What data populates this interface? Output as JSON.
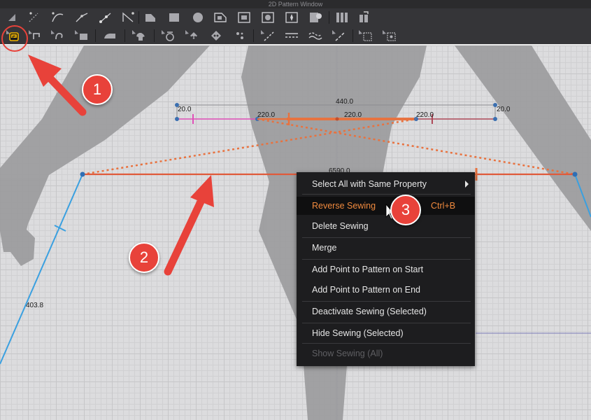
{
  "window": {
    "title": "2D Pattern Window"
  },
  "toolbar_row1_icons": [
    "select-tool-icon",
    "edit-point-icon",
    "edit-curve-icon",
    "curve-point-icon",
    "polygon-icon",
    "internal-line-icon",
    "rectangle-icon",
    "circle-icon",
    "ellipse-icon",
    "internal-polygon-icon",
    "internal-rectangle-icon",
    "internal-circle-icon",
    "dart-icon",
    "trace-icon",
    "grain-icon",
    "fold-icon"
  ],
  "toolbar_row2_icons": [
    "edit-sewing-icon",
    "segment-sewing-icon",
    "free-sewing-icon",
    "m-n-sewing-icon",
    "check-sewing-icon",
    "iron-icon",
    "fold-arrangement-icon",
    "tack-icon",
    "pin-icon",
    "button-icon",
    "buttonhole-icon",
    "topstitch-icon",
    "segment-topstitch-icon",
    "free-topstitch-icon",
    "puckering-icon",
    "zipper-icon",
    "pattern-grid-icon",
    "texture-grid-icon"
  ],
  "measurements": {
    "top_total": "440.0",
    "left_offset": "20.0",
    "right_offset": "20.0",
    "seg_left": "220.0",
    "seg_mid": "220.0",
    "seg_right": "220.0",
    "center_overlap": "6590.0",
    "left_edge": "403.8"
  },
  "context_menu": {
    "items": [
      {
        "label": "Select All with Same Property",
        "shortcut": "",
        "submenu": true,
        "state": "normal"
      },
      {
        "label": "Reverse Sewing",
        "shortcut": "Ctrl+B",
        "submenu": false,
        "state": "active"
      },
      {
        "label": "Delete Sewing",
        "shortcut": "",
        "submenu": false,
        "state": "normal"
      },
      {
        "label": "Merge",
        "shortcut": "",
        "submenu": false,
        "state": "normal"
      },
      {
        "label": "Add Point to Pattern on Start",
        "shortcut": "",
        "submenu": false,
        "state": "normal"
      },
      {
        "label": "Add Point to Pattern on End",
        "shortcut": "",
        "submenu": false,
        "state": "normal"
      },
      {
        "label": "Deactivate Sewing (Selected)",
        "shortcut": "",
        "submenu": false,
        "state": "normal"
      },
      {
        "label": "Hide Sewing (Selected)",
        "shortcut": "",
        "submenu": false,
        "state": "normal"
      },
      {
        "label": "Show Sewing (All)",
        "shortcut": "",
        "submenu": false,
        "state": "disabled"
      }
    ]
  },
  "annotations": {
    "step1": "1",
    "step2": "2",
    "step3": "3"
  },
  "colors": {
    "accent_orange": "#f08a3e",
    "sewing_line": "#e8723f",
    "pattern_line_blue": "#3aa0e0",
    "pattern_line_pink": "#e04fb8",
    "annotation_red": "#e8423a",
    "menu_bg": "#1d1d1f",
    "toolbar_bg": "#353538"
  }
}
